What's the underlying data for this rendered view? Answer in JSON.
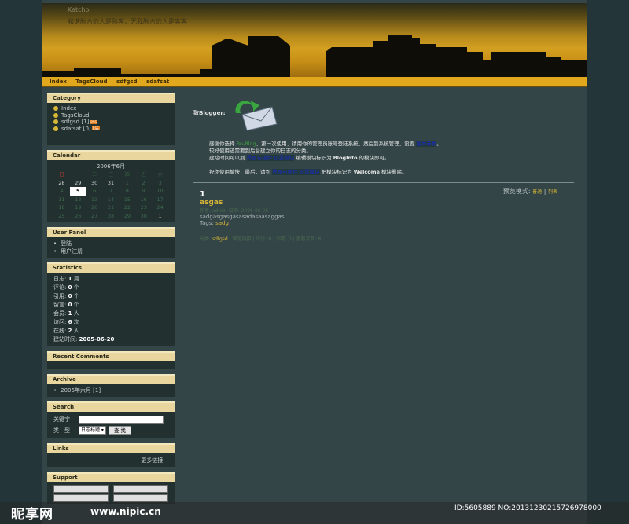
{
  "header": {
    "site_title": "Katcho",
    "site_desc": "和谐融合的人是熟客，无我融合的人是客客",
    "colors": {
      "sky": "#d4a021",
      "nav": "#e2a81d"
    }
  },
  "nav": [
    "Index",
    "TagsCloud",
    "sdfgsd",
    "sdafsat"
  ],
  "sidebar": {
    "category": {
      "title": "Category",
      "items": [
        {
          "label": "Index",
          "rss": ""
        },
        {
          "label": "TagsCloud",
          "rss": ""
        },
        {
          "label": "sdfgsd [1]",
          "rss": "RSS"
        },
        {
          "label": "sdafsat [0]",
          "rss": "RSS"
        }
      ]
    },
    "calendar": {
      "title": "Calendar",
      "month": "2006年6月",
      "weekdays": [
        "日",
        "一",
        "二",
        "三",
        "四",
        "五",
        "六"
      ],
      "weeks": [
        [
          "28",
          "29",
          "30",
          "31",
          "1",
          "2",
          "3"
        ],
        [
          "4",
          "5",
          "6",
          "7",
          "8",
          "9",
          "10"
        ],
        [
          "11",
          "12",
          "13",
          "14",
          "15",
          "16",
          "17"
        ],
        [
          "18",
          "19",
          "20",
          "21",
          "22",
          "23",
          "24"
        ],
        [
          "25",
          "26",
          "27",
          "28",
          "29",
          "30",
          "1"
        ]
      ],
      "today": "5"
    },
    "user_panel": {
      "title": "User Panel",
      "items": [
        "登陆",
        "用户注册"
      ]
    },
    "statistics": {
      "title": "Statistics",
      "rows": [
        {
          "label": "日志:",
          "value": "1",
          "unit": "篇"
        },
        {
          "label": "评论:",
          "value": "0",
          "unit": "个"
        },
        {
          "label": "引用:",
          "value": "0",
          "unit": "个"
        },
        {
          "label": "留言:",
          "value": "0",
          "unit": "个"
        },
        {
          "label": "会员:",
          "value": "1",
          "unit": "人"
        },
        {
          "label": "访问:",
          "value": "6",
          "unit": "次"
        },
        {
          "label": "在线:",
          "value": "2",
          "unit": "人"
        },
        {
          "label": "建站时间:",
          "value": "2005-06-20",
          "unit": ""
        }
      ]
    },
    "recent_comments": {
      "title": "Recent Comments"
    },
    "archive": {
      "title": "Archive",
      "items": [
        "2006年六月 [1]"
      ]
    },
    "search": {
      "title": "Search",
      "keyword_label": "关键字",
      "type_label": "类　型",
      "select_value": "日志标题",
      "button": "查 找"
    },
    "links": {
      "title": "Links",
      "more": "更多链接···"
    },
    "support": {
      "title": "Support"
    }
  },
  "main": {
    "welcome_to": "致Blogger:",
    "welcome_lines": [
      {
        "parts": [
          "感谢你选择 ",
          {
            "hl": "green",
            "t": "Bo-Blog"
          },
          "，第一次使用，请用你的管理员账号登陆系统，然后到系统管理，设置 ",
          {
            "hl": "blue",
            "t": "基本参数"
          },
          "。"
        ]
      },
      {
        "parts": [
          "较好使用还需要到后台建立你的日志的分类。"
        ]
      },
      {
        "parts": [
          "建站时间可以到 ",
          {
            "hl": "blue",
            "t": "界面与插件·设置模块"
          },
          " 编辑模块标识为 ",
          {
            "b": "BlogInfo"
          },
          " 的模块即可。"
        ]
      },
      {
        "parts": [
          ""
        ]
      },
      {
        "parts": [
          "祝你使用愉快，最后，请到 ",
          {
            "hl": "blue",
            "t": "界面与插件·设置模块"
          },
          " 把模块标识为 ",
          {
            "b": "Welcome"
          },
          " 模块删除。"
        ]
      }
    ],
    "view_mode_label": "预览模式:",
    "view_mode_options": [
      "普通",
      "列表"
    ],
    "post": {
      "day": "1",
      "title": "asgas",
      "meta": "作者: admin 日期: 2006-06-05",
      "body": "sadgasgasgasasadasaasaggas",
      "tags_label": "Tags:",
      "tag": "sadg",
      "footer_prefix": "分类:",
      "footer_category": "sdfgsd",
      "footer_rest": "| 固定链接 | 评论: 0 | 引用: 0 | 查看次数: 6"
    }
  },
  "watermark": {
    "logo": "昵享网",
    "url": "www.nipic.cn",
    "id": "ID:5605889 NO:20131230215726978000"
  }
}
